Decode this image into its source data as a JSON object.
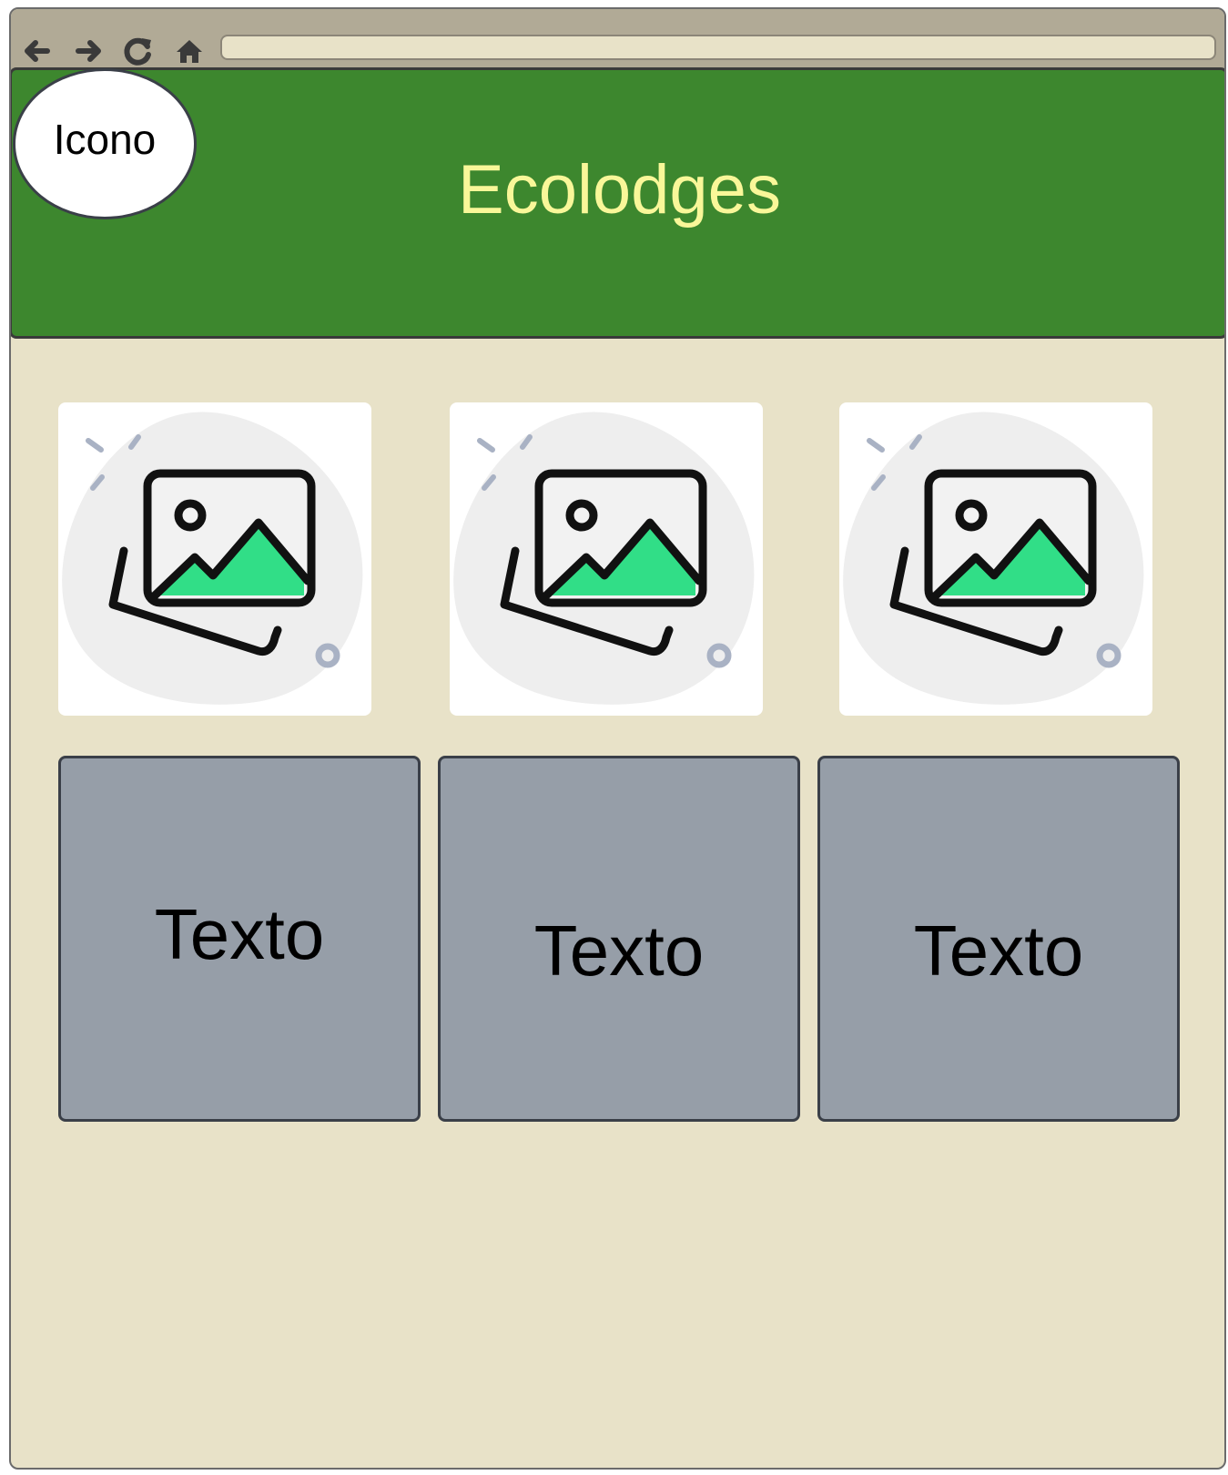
{
  "browser": {
    "address_value": "",
    "icons": [
      "arrow-left-icon",
      "arrow-right-icon",
      "reload-icon",
      "home-icon"
    ]
  },
  "header": {
    "logo_label": "Icono",
    "title": "Ecolodges",
    "colors": {
      "background": "#3d872e",
      "title": "#f9f799"
    }
  },
  "gallery": {
    "images": [
      {
        "icon": "image-placeholder-icon"
      },
      {
        "icon": "image-placeholder-icon"
      },
      {
        "icon": "image-placeholder-icon"
      }
    ]
  },
  "cards": [
    {
      "label": "Texto"
    },
    {
      "label": "Texto"
    },
    {
      "label": "Texto"
    }
  ],
  "colors": {
    "page_background": "#e8e2c8",
    "card_background": "#969ea8",
    "accent_green": "#31de87"
  }
}
